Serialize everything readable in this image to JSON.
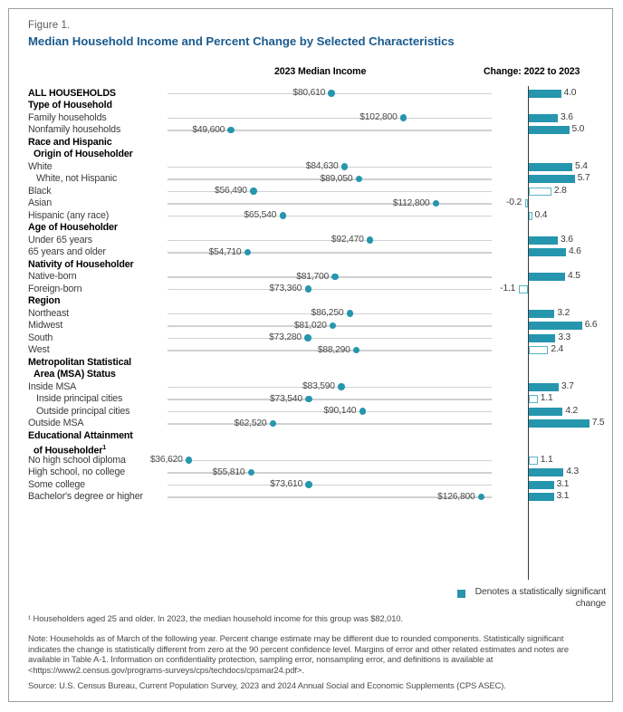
{
  "figure": {
    "label": "Figure 1.",
    "title": "Median Household Income and Percent Change by Selected Characteristics",
    "income_header": "2023 Median Income",
    "change_header": "Change: 2022 to 2023"
  },
  "legend": {
    "text": "Denotes a statistically significant change",
    "swatch_color": "#2596ad"
  },
  "footnotes": {
    "fn1": "¹ Householders aged 25 and older. In 2023, the median household income for this group was $82,010.",
    "note": "Note: Households as of March of the following year. Percent change estimate may be different due to rounded components. Statistically significant indicates the change is statistically different from zero at the 90 percent confidence level. Margins of error and other related estimates and notes are available in Table A-1. Information on confidentiality protection, sampling error, nonsampling error, and definitions is available at <https://www2.census.gov/programs-surveys/cps/techdocs/cpsmar24.pdf>.",
    "source": "Source: U.S. Census Bureau, Current Population Survey, 2023 and 2024 Annual Social and Economic Supplements (CPS ASEC)."
  },
  "colors": {
    "title": "#1a5a8e",
    "accent": "#2596ad",
    "track": "#cfd1d2",
    "axis": "#3b3b3b"
  },
  "chart_data": {
    "type": "bar",
    "title": "Median Household Income and Percent Change by Selected Characteristics",
    "xlabel": "",
    "ylabel": "",
    "panels": [
      "2023 Median Income",
      "Change: 2022 to 2023"
    ],
    "income_label_prefix": "$",
    "income_range": [
      30000,
      130000
    ],
    "change_range": [
      -2,
      8
    ],
    "rows": [
      {
        "label": "ALL HOUSEHOLDS",
        "style": "bold",
        "income": 80610,
        "income_text": "$80,610",
        "change": 4.0,
        "change_text": "4.0",
        "significant": true
      },
      {
        "label": "Type of Household",
        "style": "bold",
        "income": null,
        "income_text": "",
        "change": null,
        "change_text": "",
        "significant": null
      },
      {
        "label": "Family households",
        "style": "plain",
        "income": 102800,
        "income_text": "$102,800",
        "change": 3.6,
        "change_text": "3.6",
        "significant": true
      },
      {
        "label": "Nonfamily households",
        "style": "plain",
        "income": 49600,
        "income_text": "$49,600",
        "change": 5.0,
        "change_text": "5.0",
        "significant": true
      },
      {
        "label": "Race and Hispanic",
        "style": "bold",
        "income": null,
        "income_text": "",
        "change": null,
        "change_text": "",
        "significant": null
      },
      {
        "label": "Origin of Householder",
        "style": "bold-indent1",
        "income": null,
        "income_text": "",
        "change": null,
        "change_text": "",
        "significant": null
      },
      {
        "label": "White",
        "style": "plain",
        "income": 84630,
        "income_text": "$84,630",
        "change": 5.4,
        "change_text": "5.4",
        "significant": true
      },
      {
        "label": "White, not Hispanic",
        "style": "indent2",
        "income": 89050,
        "income_text": "$89,050",
        "change": 5.7,
        "change_text": "5.7",
        "significant": true
      },
      {
        "label": "Black",
        "style": "plain",
        "income": 56490,
        "income_text": "$56,490",
        "change": 2.8,
        "change_text": "2.8",
        "significant": false
      },
      {
        "label": "Asian",
        "style": "plain",
        "income": 112800,
        "income_text": "$112,800",
        "change": -0.2,
        "change_text": "-0.2",
        "significant": false
      },
      {
        "label": "Hispanic (any race)",
        "style": "plain",
        "income": 65540,
        "income_text": "$65,540",
        "change": 0.4,
        "change_text": "0.4",
        "significant": false
      },
      {
        "label": "Age of Householder",
        "style": "bold",
        "income": null,
        "income_text": "",
        "change": null,
        "change_text": "",
        "significant": null
      },
      {
        "label": "Under 65 years",
        "style": "plain",
        "income": 92470,
        "income_text": "$92,470",
        "change": 3.6,
        "change_text": "3.6",
        "significant": true
      },
      {
        "label": "65 years and older",
        "style": "plain",
        "income": 54710,
        "income_text": "$54,710",
        "change": 4.6,
        "change_text": "4.6",
        "significant": true
      },
      {
        "label": "Nativity of Householder",
        "style": "bold",
        "income": null,
        "income_text": "",
        "change": null,
        "change_text": "",
        "significant": null
      },
      {
        "label": "Native-born",
        "style": "plain",
        "income": 81700,
        "income_text": "$81,700",
        "change": 4.5,
        "change_text": "4.5",
        "significant": true
      },
      {
        "label": "Foreign-born",
        "style": "plain",
        "income": 73360,
        "income_text": "$73,360",
        "change": -1.1,
        "change_text": "-1.1",
        "significant": false
      },
      {
        "label": "Region",
        "style": "bold",
        "income": null,
        "income_text": "",
        "change": null,
        "change_text": "",
        "significant": null
      },
      {
        "label": "Northeast",
        "style": "plain",
        "income": 86250,
        "income_text": "$86,250",
        "change": 3.2,
        "change_text": "3.2",
        "significant": true
      },
      {
        "label": "Midwest",
        "style": "plain",
        "income": 81020,
        "income_text": "$81,020",
        "change": 6.6,
        "change_text": "6.6",
        "significant": true
      },
      {
        "label": "South",
        "style": "plain",
        "income": 73280,
        "income_text": "$73,280",
        "change": 3.3,
        "change_text": "3.3",
        "significant": true
      },
      {
        "label": "West",
        "style": "plain",
        "income": 88290,
        "income_text": "$88,290",
        "change": 2.4,
        "change_text": "2.4",
        "significant": false
      },
      {
        "label": "Metropolitan Statistical",
        "style": "bold",
        "income": null,
        "income_text": "",
        "change": null,
        "change_text": "",
        "significant": null
      },
      {
        "label": "Area (MSA) Status",
        "style": "bold-indent1",
        "income": null,
        "income_text": "",
        "change": null,
        "change_text": "",
        "significant": null
      },
      {
        "label": "Inside MSA",
        "style": "plain",
        "income": 83590,
        "income_text": "$83,590",
        "change": 3.7,
        "change_text": "3.7",
        "significant": true
      },
      {
        "label": "Inside principal cities",
        "style": "indent2",
        "income": 73540,
        "income_text": "$73,540",
        "change": 1.1,
        "change_text": "1.1",
        "significant": false
      },
      {
        "label": "Outside principal cities",
        "style": "indent2",
        "income": 90140,
        "income_text": "$90,140",
        "change": 4.2,
        "change_text": "4.2",
        "significant": true
      },
      {
        "label": "Outside MSA",
        "style": "plain",
        "income": 62520,
        "income_text": "$62,520",
        "change": 7.5,
        "change_text": "7.5",
        "significant": true
      },
      {
        "label": "Educational Attainment",
        "style": "bold",
        "income": null,
        "income_text": "",
        "change": null,
        "change_text": "",
        "significant": null
      },
      {
        "label": "of Householder¹",
        "style": "bold-indent1",
        "income": null,
        "income_text": "",
        "change": null,
        "change_text": "",
        "significant": null
      },
      {
        "label": "No high school diploma",
        "style": "plain",
        "income": 36620,
        "income_text": "$36,620",
        "change": 1.1,
        "change_text": "1.1",
        "significant": false
      },
      {
        "label": "High school, no college",
        "style": "plain",
        "income": 55810,
        "income_text": "$55,810",
        "change": 4.3,
        "change_text": "4.3",
        "significant": true
      },
      {
        "label": "Some college",
        "style": "plain",
        "income": 73610,
        "income_text": "$73,610",
        "change": 3.1,
        "change_text": "3.1",
        "significant": true
      },
      {
        "label": "Bachelor's degree or higher",
        "style": "plain",
        "income": 126800,
        "income_text": "$126,800",
        "change": 3.1,
        "change_text": "3.1",
        "significant": true
      }
    ]
  }
}
